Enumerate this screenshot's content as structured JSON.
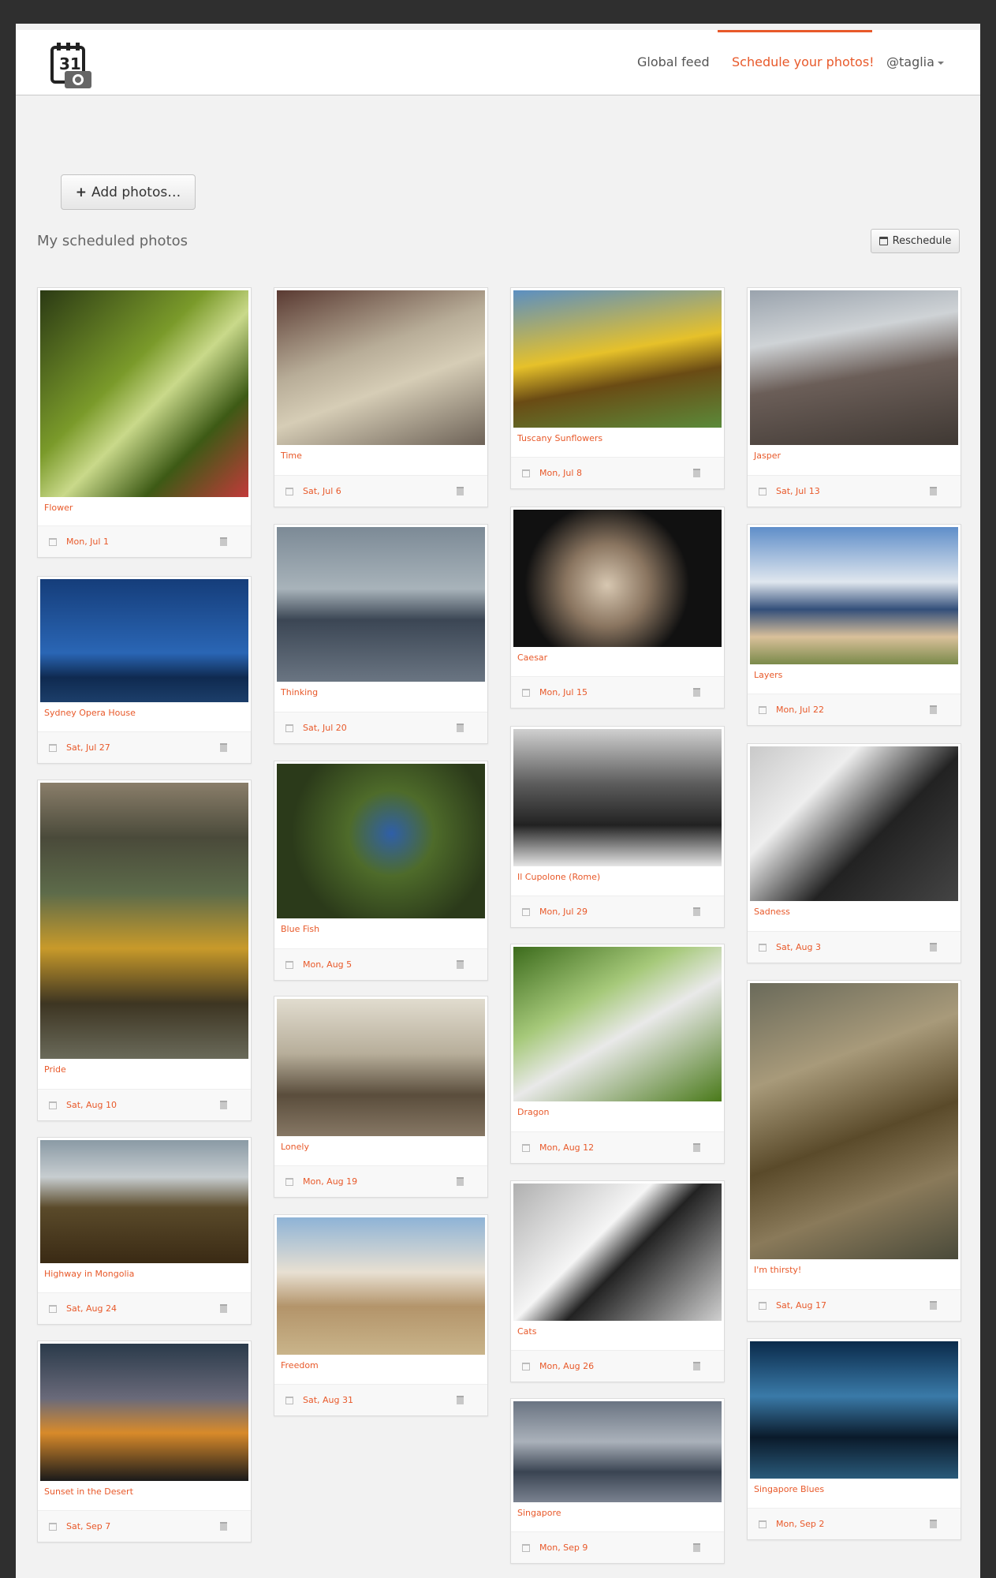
{
  "navbar": {
    "logo_text": "31",
    "links": [
      {
        "label": "Global feed"
      },
      {
        "label": "Schedule your photos!"
      },
      {
        "label": "@taglia"
      }
    ]
  },
  "toolbar": {
    "add_label": "Add photos…",
    "section_title": "My scheduled photos",
    "reschedule_label": "Reschedule"
  },
  "colors": {
    "accent": "#e8592a",
    "background": "#f2f2f2",
    "outer": "#2f2f2f"
  },
  "photos": [
    {
      "title": "Flower",
      "date": "Mon, Jul 1",
      "icon": "calendar-icon"
    },
    {
      "title": "Time",
      "date": "Sat, Jul 6"
    },
    {
      "title": "Tuscany Sunflowers",
      "date": "Mon, Jul 8"
    },
    {
      "title": "Jasper",
      "date": "Sat, Jul 13"
    },
    {
      "title": "Sydney Opera House",
      "date": "Sat, Jul 27"
    },
    {
      "title": "Thinking",
      "date": "Sat, Jul 20"
    },
    {
      "title": "Caesar",
      "date": "Mon, Jul 15"
    },
    {
      "title": "Layers",
      "date": "Mon, Jul 22"
    },
    {
      "title": "Pride",
      "date": "Sat, Aug 10"
    },
    {
      "title": "Blue Fish",
      "date": "Mon, Aug 5"
    },
    {
      "title": "Il Cupolone (Rome)",
      "date": "Mon, Jul 29"
    },
    {
      "title": "Sadness",
      "date": "Sat, Aug 3"
    },
    {
      "title": "Highway in Mongolia",
      "date": "Sat, Aug 24"
    },
    {
      "title": "Lonely",
      "date": "Mon, Aug 19"
    },
    {
      "title": "Dragon",
      "date": "Mon, Aug 12"
    },
    {
      "title": "I'm thirsty!",
      "date": "Sat, Aug 17"
    },
    {
      "title": "Sunset in the Desert",
      "date": "Sat, Sep 7"
    },
    {
      "title": "Freedom",
      "date": "Sat, Aug 31"
    },
    {
      "title": "Cats",
      "date": "Mon, Aug 26"
    },
    {
      "title": "Singapore Blues",
      "date": "Mon, Sep 2"
    },
    {
      "title": "Singapore",
      "date": "Mon, Sep 9"
    }
  ]
}
